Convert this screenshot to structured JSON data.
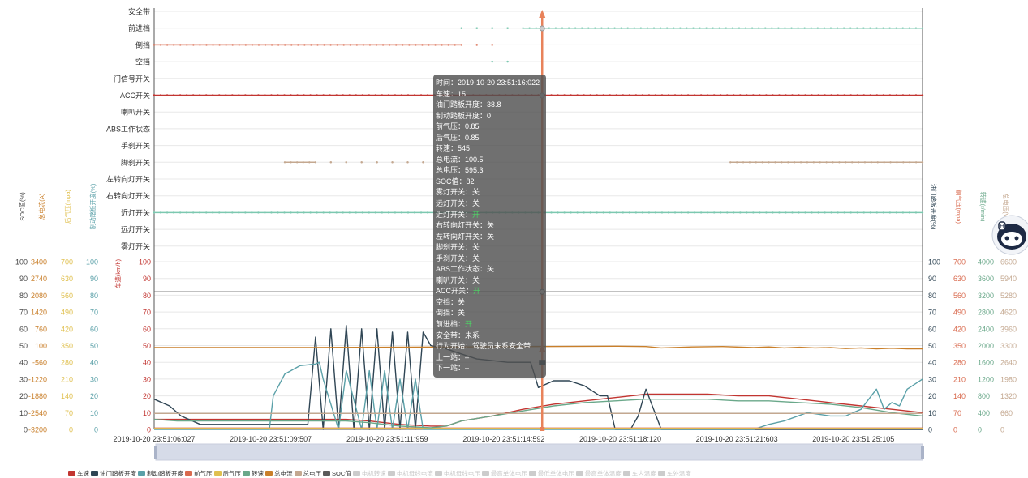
{
  "chart_data": {
    "type": "line",
    "x": [
      "2019-10-20 23:51:06:027",
      "2019-10-20 23:51:09:507",
      "2019-10-20 23:51:11:959",
      "2019-10-20 23:51:14:592",
      "2019-10-20 23:51:18:120",
      "2019-10-20 23:51:21:603",
      "2019-10-20 23:51:25:105"
    ],
    "x_labels": [
      "2019-10-20 23:51:06:027",
      "2019-10-20 23:51:09:507",
      "2019-10-20 23:51:11:959",
      "2019-10-20 23:51:14:592",
      "2019-10-20 23:51:18:120",
      "2019-10-20 23:51:21:603",
      "2019-10-20 23:51:25:105"
    ],
    "xlim": [
      0,
      1
    ],
    "switch_axis": {
      "categories": [
        "安全带",
        "前进档",
        "倒挡",
        "空挡",
        "门信号开关",
        "ACC开关",
        "喇叭开关",
        "ABS工作状态",
        "手刹开关",
        "脚刹开关",
        "左转向灯开关",
        "右转向灯开关",
        "近灯开关",
        "远灯开关",
        "雾灯开关"
      ]
    },
    "switch_series": [
      {
        "category": "前进档",
        "segments": [
          [
            0.4,
            0.4
          ],
          [
            0.42,
            0.42
          ],
          [
            0.44,
            0.44
          ],
          [
            0.46,
            0.46
          ],
          [
            0.48,
            1.0
          ]
        ],
        "color": "#7cc8b0"
      },
      {
        "category": "倒挡",
        "segments": [
          [
            0.0,
            0.4
          ],
          [
            0.42,
            0.42
          ],
          [
            0.44,
            0.44
          ]
        ],
        "color": "#d96a4e"
      },
      {
        "category": "空挡",
        "segments": [
          [
            0.44,
            0.44
          ],
          [
            0.46,
            0.46
          ]
        ],
        "color": "#7cc8b0"
      },
      {
        "category": "ACC开关",
        "segments": [
          [
            0.0,
            1.0
          ]
        ],
        "color": "#c23531"
      },
      {
        "category": "脚刹开关",
        "segments": [
          [
            0.17,
            0.21
          ],
          [
            0.23,
            0.23
          ],
          [
            0.25,
            0.25
          ],
          [
            0.27,
            0.27
          ],
          [
            0.29,
            0.29
          ],
          [
            0.31,
            0.31
          ],
          [
            0.33,
            0.33
          ],
          [
            0.35,
            0.35
          ],
          [
            0.75,
            1.0
          ]
        ],
        "color": "#c4a890"
      },
      {
        "category": "近灯开关",
        "segments": [
          [
            0.0,
            1.0
          ]
        ],
        "color": "#7cc8b0"
      }
    ],
    "left_axes": [
      {
        "name": "SOC值(%)",
        "ticks": [
          "0",
          "10",
          "20",
          "30",
          "40",
          "50",
          "60",
          "70",
          "80",
          "90",
          "100"
        ],
        "color": "#444444"
      },
      {
        "name": "总电流(A)",
        "ticks": [
          "-3200",
          "-2540",
          "-1880",
          "-1220",
          "-560",
          "100",
          "760",
          "1420",
          "2080",
          "2740",
          "3400"
        ],
        "color": "#c97f2a"
      },
      {
        "name": "后气压(mpa)",
        "ticks": [
          "0",
          "70",
          "140",
          "210",
          "280",
          "350",
          "420",
          "490",
          "560",
          "630",
          "700"
        ],
        "color": "#e0c050"
      },
      {
        "name": "制动踏板开度(%)",
        "ticks": [
          "0",
          "10",
          "20",
          "30",
          "40",
          "50",
          "60",
          "70",
          "80",
          "90",
          "100"
        ],
        "color": "#5aa0a8"
      },
      {
        "name": "车速(km/h)",
        "ticks": [
          "0",
          "10",
          "20",
          "30",
          "40",
          "50",
          "60",
          "70",
          "80",
          "90",
          "100"
        ],
        "color": "#c23531"
      }
    ],
    "right_axes": [
      {
        "name": "油门踏板开度(%)",
        "ticks": [
          "0",
          "10",
          "20",
          "30",
          "40",
          "50",
          "60",
          "70",
          "80",
          "90",
          "100"
        ],
        "color": "#2f4554"
      },
      {
        "name": "前气压(mpa)",
        "ticks": [
          "0",
          "70",
          "140",
          "210",
          "280",
          "350",
          "420",
          "490",
          "560",
          "630",
          "700"
        ],
        "color": "#d96a4e"
      },
      {
        "name": "转速(r/min)",
        "ticks": [
          "0",
          "400",
          "800",
          "1200",
          "1600",
          "2000",
          "2400",
          "2800",
          "3200",
          "3600",
          "4000"
        ],
        "color": "#6aa88a"
      },
      {
        "name": "总电压(V)",
        "ticks": [
          "0",
          "660",
          "1320",
          "1980",
          "2640",
          "3300",
          "3960",
          "4620",
          "5280",
          "5940",
          "6600"
        ],
        "color": "#c4a890"
      }
    ],
    "ylim": [
      0,
      100
    ],
    "series": [
      {
        "name": "车速",
        "color": "#c23531",
        "x": [
          0,
          0.03,
          0.25,
          0.28,
          0.32,
          0.36,
          0.38,
          0.4,
          0.44,
          0.48,
          0.52,
          0.56,
          0.6,
          0.64,
          0.68,
          0.72,
          0.76,
          0.8,
          0.84,
          0.88,
          0.92,
          0.96,
          1.0
        ],
        "values": [
          6,
          6,
          6,
          5,
          3,
          2,
          2,
          5,
          8,
          12,
          15,
          17,
          19,
          21,
          21,
          21,
          20,
          20,
          18,
          16,
          14,
          12,
          10
        ]
      },
      {
        "name": "油门踏板开度",
        "color": "#2f4554",
        "x": [
          0,
          0.02,
          0.035,
          0.06,
          0.2,
          0.21,
          0.22,
          0.23,
          0.24,
          0.25,
          0.26,
          0.27,
          0.28,
          0.29,
          0.3,
          0.31,
          0.32,
          0.33,
          0.34,
          0.35,
          0.36,
          0.38,
          0.4,
          0.42,
          0.44,
          0.46,
          0.49,
          0.5,
          0.52,
          0.54,
          0.56,
          0.58,
          0.59,
          0.6,
          0.62,
          0.63,
          0.64,
          0.65,
          0.66,
          0.67,
          0.7,
          0.75,
          0.8,
          0.85,
          0.9,
          0.95,
          1.0
        ],
        "values": [
          18,
          14,
          8,
          3,
          3,
          55,
          0,
          60,
          0,
          62,
          0,
          60,
          0,
          60,
          0,
          58,
          0,
          58,
          0,
          58,
          50,
          48,
          45,
          42,
          41,
          40,
          40,
          25,
          29,
          29,
          26,
          20,
          20,
          0,
          0,
          8,
          24,
          12,
          0,
          0,
          0,
          0,
          0,
          0,
          0,
          0,
          0
        ]
      },
      {
        "name": "制动踏板开度",
        "color": "#5aa0a8",
        "x": [
          0,
          0.1,
          0.15,
          0.155,
          0.17,
          0.19,
          0.21,
          0.215,
          0.22,
          0.24,
          0.25,
          0.27,
          0.28,
          0.29,
          0.3,
          0.31,
          0.32,
          0.33,
          0.34,
          0.35,
          0.37,
          0.4,
          0.5,
          0.6,
          0.7,
          0.75,
          0.78,
          0.8,
          0.82,
          0.85,
          0.88,
          0.9,
          0.92,
          0.94,
          0.95,
          0.96,
          0.97,
          0.98,
          1.0
        ],
        "values": [
          0,
          0,
          0,
          20,
          33,
          38,
          39,
          40,
          30,
          0,
          35,
          0,
          35,
          0,
          35,
          0,
          30,
          0,
          30,
          0,
          0,
          0,
          0,
          0,
          0,
          0,
          0,
          3,
          5,
          10,
          8,
          8,
          12,
          24,
          12,
          16,
          14,
          24,
          30
        ]
      },
      {
        "name": "前气压",
        "color": "#d96a4e",
        "x": [
          0,
          1.0
        ],
        "values": [
          0.8,
          0.8
        ]
      },
      {
        "name": "后气压",
        "color": "#e0c050",
        "x": [
          0,
          1.0
        ],
        "values": [
          0.6,
          0.6
        ]
      },
      {
        "name": "转速",
        "color": "#6aa88a",
        "x": [
          0,
          0.03,
          0.25,
          0.28,
          0.32,
          0.36,
          0.38,
          0.4,
          0.44,
          0.48,
          0.52,
          0.56,
          0.6,
          0.64,
          0.68,
          0.72,
          0.76,
          0.8,
          0.84,
          0.88,
          0.92,
          0.96,
          1.0
        ],
        "values": [
          6,
          5,
          5,
          4,
          2,
          1,
          2,
          5,
          8,
          11,
          14,
          16,
          17,
          18,
          18,
          18,
          17,
          17,
          16,
          15,
          13,
          10,
          8
        ]
      },
      {
        "name": "总电流",
        "color": "#c97f2a",
        "x": [
          0,
          0.1,
          0.2,
          0.3,
          0.4,
          0.5,
          0.6,
          0.64,
          0.66,
          0.7,
          0.74,
          0.78,
          0.8,
          0.82,
          0.84,
          0.86,
          0.88,
          0.9,
          0.92,
          0.94,
          0.96,
          0.98,
          1.0
        ],
        "values": [
          48.8,
          48.8,
          48.8,
          49,
          49.2,
          49.4,
          49.6,
          49.4,
          48.6,
          49.2,
          49.4,
          48.8,
          49.2,
          48.6,
          49,
          48.6,
          48.8,
          48.2,
          48.6,
          48,
          48.4,
          48,
          48
        ]
      },
      {
        "name": "总电压",
        "color": "#c4a890",
        "x": [
          0,
          1.0
        ],
        "values": [
          9.5,
          9.5
        ]
      },
      {
        "name": "SOC值",
        "color": "#5a5a5a",
        "x": [
          0,
          1.0
        ],
        "values": [
          82,
          82
        ]
      }
    ],
    "cursor": {
      "x": 0.505
    },
    "legend": {
      "position": "bottom-left",
      "items": [
        {
          "label": "车速",
          "color": "#c23531",
          "active": true
        },
        {
          "label": "油门踏板开度",
          "color": "#2f4554",
          "active": true
        },
        {
          "label": "制动踏板开度",
          "color": "#5aa0a8",
          "active": true
        },
        {
          "label": "前气压",
          "color": "#d96a4e",
          "active": true
        },
        {
          "label": "后气压",
          "color": "#e0c050",
          "active": true
        },
        {
          "label": "转速",
          "color": "#6aa88a",
          "active": true
        },
        {
          "label": "总电流",
          "color": "#c97f2a",
          "active": true
        },
        {
          "label": "总电压",
          "color": "#c4a890",
          "active": true
        },
        {
          "label": "SOC值",
          "color": "#5a5a5a",
          "active": true
        },
        {
          "label": "电机转速",
          "color": "#cccccc",
          "active": false
        },
        {
          "label": "电机母线电流",
          "color": "#cccccc",
          "active": false
        },
        {
          "label": "电机母线电压",
          "color": "#cccccc",
          "active": false
        },
        {
          "label": "最高单体电压",
          "color": "#cccccc",
          "active": false
        },
        {
          "label": "最低单体电压",
          "color": "#cccccc",
          "active": false
        },
        {
          "label": "最高单体温度",
          "color": "#cccccc",
          "active": false
        },
        {
          "label": "车内温度",
          "color": "#cccccc",
          "active": false
        },
        {
          "label": "车外温度",
          "color": "#cccccc",
          "active": false
        }
      ]
    }
  },
  "tooltip": {
    "lines": [
      {
        "text": "时间：2019-10-20 23:51:16:022"
      },
      {
        "text": "车速：15"
      },
      {
        "text": "油门踏板开度：38.8"
      },
      {
        "text": "制动踏板开度：0"
      },
      {
        "text": "前气压：0.85"
      },
      {
        "text": "后气压：0.85"
      },
      {
        "text": "转速：545"
      },
      {
        "text": "总电流：100.5"
      },
      {
        "text": "总电压：595.3"
      },
      {
        "text": "SOC值：82"
      },
      {
        "text": "雾灯开关：关"
      },
      {
        "text": "远灯开关：关"
      },
      {
        "text": "近灯开关：",
        "highlight": "开"
      },
      {
        "text": "右转向灯开关：关"
      },
      {
        "text": "左转向灯开关：关"
      },
      {
        "text": "脚刹开关：关"
      },
      {
        "text": "手刹开关：关"
      },
      {
        "text": "ABS工作状态：关"
      },
      {
        "text": "喇叭开关：关"
      },
      {
        "text": "ACC开关：",
        "highlight": "开"
      },
      {
        "text": "空挡：关"
      },
      {
        "text": "倒挡：关"
      },
      {
        "text": "前进档：",
        "highlight": "开"
      },
      {
        "text": "安全带：未系"
      },
      {
        "text": "行为开始：驾驶员未系安全带"
      },
      {
        "text": "上一站：–"
      },
      {
        "text": "下一站：–"
      }
    ]
  },
  "colors": {
    "grid": "#e8e8e8",
    "axis": "#555555",
    "cursor": "#e8825a",
    "zoom_fill": "#d6dbe8",
    "zoom_handle": "#aab3c8"
  },
  "assistant": {
    "icon": "robot-assistant-icon"
  }
}
